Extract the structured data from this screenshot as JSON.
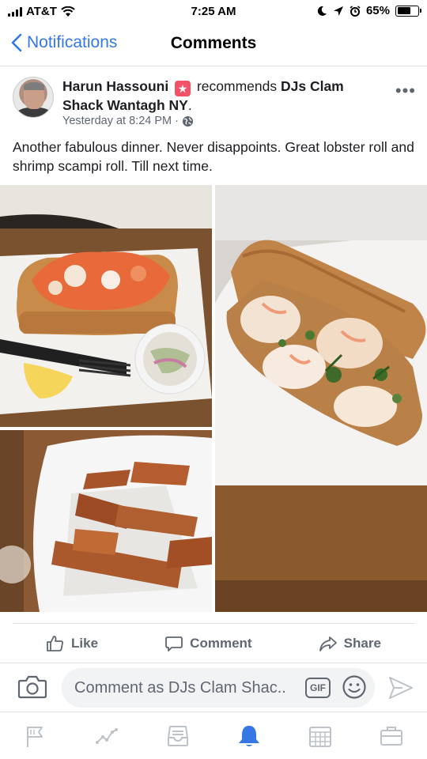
{
  "status_bar": {
    "carrier": "AT&T",
    "time": "7:25 AM",
    "battery": "65%",
    "battery_level": 0.65,
    "icons": [
      "signal-icon",
      "wifi-icon",
      "do-not-disturb-icon",
      "location-icon",
      "alarm-icon",
      "battery-icon"
    ]
  },
  "nav": {
    "back_label": "Notifications",
    "title": "Comments"
  },
  "post": {
    "author": "Harun Hassouni",
    "recommends_word": "recommends",
    "page_name": "DJs Clam Shack Wantagh NY",
    "timestamp": "Yesterday at 8:24 PM",
    "separator": "·",
    "privacy_icon": "globe-icon",
    "text": "Another fabulous dinner.  Never disappoints.  Great lobster roll and shrimp scampi roll. Till next time."
  },
  "actions": {
    "like": "Like",
    "comment": "Comment",
    "share": "Share"
  },
  "composer": {
    "placeholder": "Comment as DJs Clam Shac...",
    "gif_label": "GIF"
  },
  "tabs": [
    "flag-icon",
    "activity-icon",
    "inbox-icon",
    "notifications-bell-icon",
    "calendar-icon",
    "briefcase-icon"
  ],
  "colors": {
    "accent": "#3578e5",
    "text": "#1c1e21",
    "secondary": "#606770",
    "badge": "#f35369"
  }
}
